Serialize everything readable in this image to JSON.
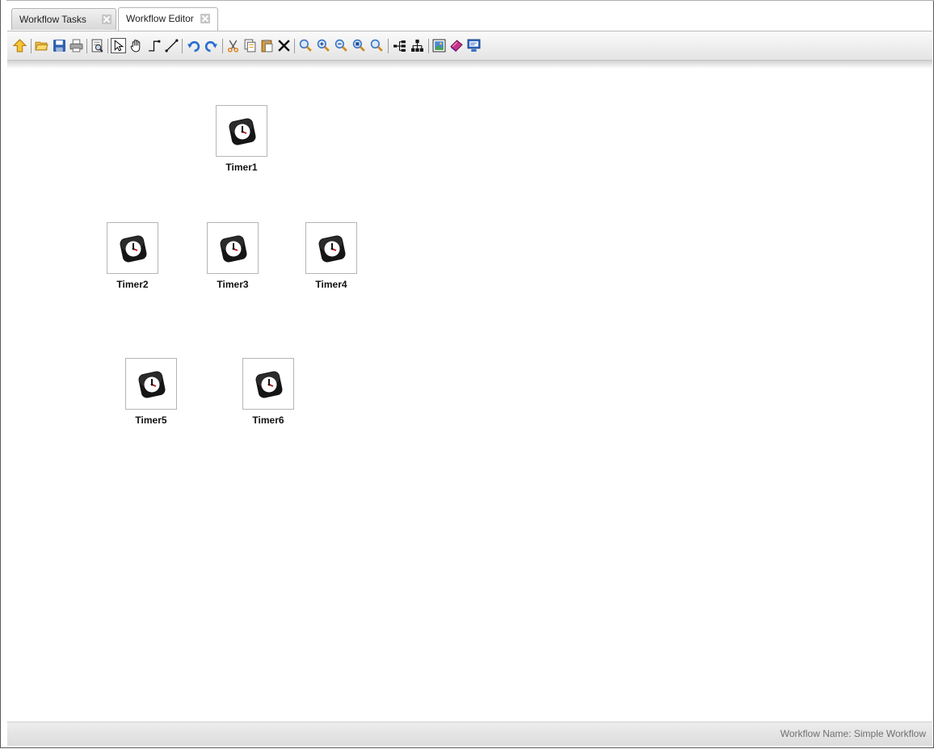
{
  "tabs": [
    {
      "label": "Workflow Tasks",
      "active": false
    },
    {
      "label": "Workflow Editor",
      "active": true
    }
  ],
  "toolbar": {
    "groups": [
      [
        "up-arrow-icon"
      ],
      [
        "open-folder-icon",
        "save-icon",
        "print-icon"
      ],
      [
        "print-preview-icon"
      ],
      [
        "select-pointer-icon",
        "pan-hand-icon",
        "orthogonal-connector-icon",
        "straight-connector-icon"
      ],
      [
        "undo-icon",
        "redo-icon"
      ],
      [
        "cut-icon",
        "copy-icon",
        "paste-icon",
        "delete-icon"
      ],
      [
        "zoom-icon",
        "zoom-in-icon",
        "zoom-out-icon",
        "zoom-fit-icon",
        "zoom-actual-icon"
      ],
      [
        "horizontal-layout-icon",
        "vertical-layout-icon"
      ],
      [
        "export-image-icon",
        "properties-book-icon",
        "monitor-icon"
      ]
    ]
  },
  "nodes": [
    {
      "label": "Timer1",
      "icon": "timer-clock-icon"
    },
    {
      "label": "Timer2",
      "icon": "timer-clock-icon"
    },
    {
      "label": "Timer3",
      "icon": "timer-clock-icon"
    },
    {
      "label": "Timer4",
      "icon": "timer-clock-icon"
    },
    {
      "label": "Timer5",
      "icon": "timer-clock-icon"
    },
    {
      "label": "Timer6",
      "icon": "timer-clock-icon"
    }
  ],
  "status": {
    "workflow_name": "Workflow Name: Simple Workflow"
  }
}
